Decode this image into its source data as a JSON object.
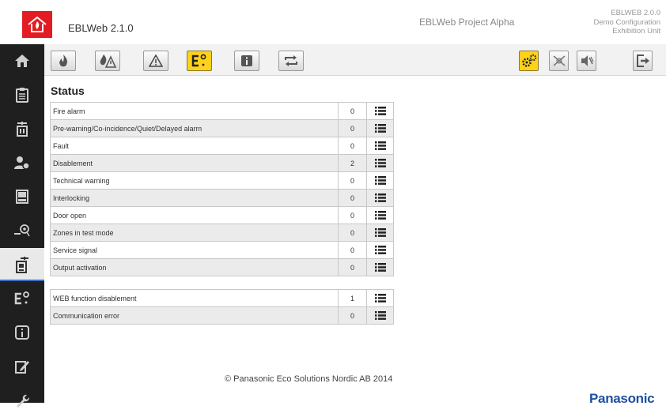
{
  "header": {
    "app_name": "EBLWeb 2.1.0",
    "project_name": "EBLWeb Project Alpha",
    "info_line1": "EBLWEB 2.0.0",
    "info_line2": "Demo Configuration",
    "info_line3": "Exhibition Unit",
    "logo_color": "#e31b23"
  },
  "sidebar": {
    "items": [
      {
        "icon": "home-icon"
      },
      {
        "icon": "clipboard-icon"
      },
      {
        "icon": "panel-icon"
      },
      {
        "icon": "user-settings-icon"
      },
      {
        "icon": "device-icon"
      },
      {
        "icon": "detector-icon"
      },
      {
        "icon": "status-panel-icon",
        "active": true
      },
      {
        "icon": "io-unit-icon"
      },
      {
        "icon": "info-icon"
      },
      {
        "icon": "edit-icon"
      },
      {
        "icon": "wrench-icon"
      }
    ]
  },
  "toolbar": {
    "selected_color": "#ffd21a",
    "buttons": [
      {
        "icon": "fire-icon"
      },
      {
        "icon": "pre-warning-icon"
      },
      {
        "icon": "fault-icon"
      },
      {
        "icon": "io-unit-icon",
        "selected": true
      },
      {
        "icon": "info-icon"
      },
      {
        "icon": "refresh-icon"
      }
    ],
    "right_buttons": [
      {
        "icon": "settings-icon",
        "selected": true
      },
      {
        "icon": "disable-icon"
      },
      {
        "icon": "mute-icon"
      },
      {
        "icon": "logout-icon"
      }
    ]
  },
  "main": {
    "title": "Status",
    "rows": [
      {
        "label": "Fire alarm",
        "count": "0"
      },
      {
        "label": "Pre-warning/Co-incidence/Quiet/Delayed alarm",
        "count": "0"
      },
      {
        "label": "Fault",
        "count": "0"
      },
      {
        "label": "Disablement",
        "count": "2"
      },
      {
        "label": "Technical warning",
        "count": "0"
      },
      {
        "label": "Interlocking",
        "count": "0"
      },
      {
        "label": "Door open",
        "count": "0"
      },
      {
        "label": "Zones in test mode",
        "count": "0"
      },
      {
        "label": "Service signal",
        "count": "0"
      },
      {
        "label": "Output activation",
        "count": "0"
      }
    ],
    "rows2": [
      {
        "label": "WEB function disablement",
        "count": "1"
      },
      {
        "label": "Communication error",
        "count": "0"
      }
    ]
  },
  "footer": {
    "copyright": "© Panasonic Eco Solutions Nordic AB 2014",
    "brand": "Panasonic",
    "brand_color": "#1f4fa0"
  }
}
